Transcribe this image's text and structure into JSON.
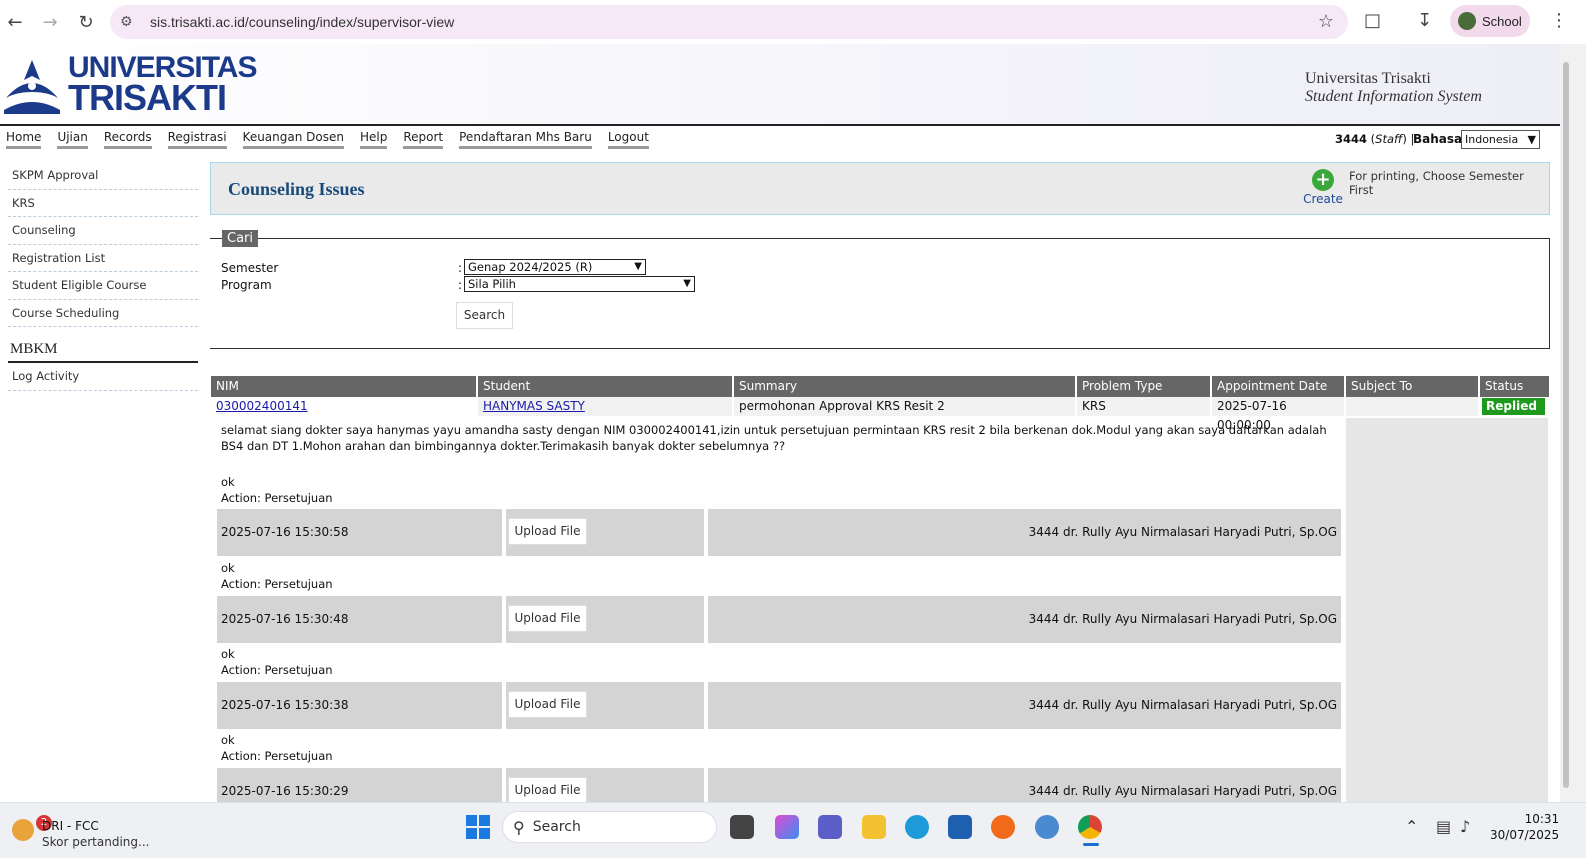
{
  "browser": {
    "url": "sis.trisakti.ac.id/counseling/index/supervisor-view",
    "profile_label": "School"
  },
  "header": {
    "logo_line1": "UNIVERSITAS",
    "logo_line2": "TRISAKTI",
    "university_name": "Universitas Trisakti",
    "system_name": "Student Information System"
  },
  "menu": {
    "items": [
      "Home",
      "Ujian",
      "Records",
      "Registrasi",
      "Keuangan Dosen",
      "Help",
      "Report",
      "Pendaftaran Mhs Baru",
      "Logout"
    ],
    "user_id": "3444",
    "user_role": "Staff",
    "language_label": "Bahasa:",
    "language_value": "Indonesia"
  },
  "sidebar": {
    "items": [
      "SKPM Approval",
      "KRS",
      "Counseling",
      "Registration List",
      "Student Eligible Course",
      "Course Scheduling"
    ],
    "mbkm_heading": "MBKM",
    "mbkm_items": [
      "Log Activity"
    ]
  },
  "page": {
    "title": "Counseling Issues",
    "create_label": "Create",
    "print_note": "For printing, Choose Semester First"
  },
  "search": {
    "legend": "Cari",
    "semester_label": "Semester",
    "semester_value": "Genap 2024/2025 (R)",
    "program_label": "Program",
    "program_value": "Sila Pilih",
    "button_label": "Search"
  },
  "table": {
    "headers": [
      "NIM",
      "Student",
      "Summary",
      "Problem Type",
      "Appointment Date",
      "Subject To",
      "Status"
    ],
    "row": {
      "nim": "030002400141",
      "student": "HANYMAS SASTY",
      "summary": "permohonan Approval KRS Resit 2",
      "problem_type": "KRS",
      "appointment_date": "2025-07-16 00:00:00",
      "subject_to": "",
      "status": "Replied"
    },
    "message": "selamat siang dokter saya hanymas yayu amandha sasty dengan NIM 030002400141,izin untuk persetujuan permintaan KRS resit 2 bila berkenan dok.Modul yang akan saya daftarkan adalah BS4 dan DT 1.Mohon arahan dan bimbingannya dokter.Terimakasih banyak dokter sebelumnya ??",
    "replies": [
      {
        "text": "ok",
        "action": "Action: Persetujuan",
        "date": "2025-07-16 15:30:58",
        "upload": "Upload File",
        "author": "3444 dr. Rully Ayu Nirmalasari Haryadi Putri, Sp.OG"
      },
      {
        "text": "ok",
        "action": "Action: Persetujuan",
        "date": "2025-07-16 15:30:48",
        "upload": "Upload File",
        "author": "3444 dr. Rully Ayu Nirmalasari Haryadi Putri, Sp.OG"
      },
      {
        "text": "ok",
        "action": "Action: Persetujuan",
        "date": "2025-07-16 15:30:38",
        "upload": "Upload File",
        "author": "3444 dr. Rully Ayu Nirmalasari Haryadi Putri, Sp.OG"
      },
      {
        "text": "ok",
        "action": "Action: Persetujuan",
        "date": "2025-07-16 15:30:29",
        "upload": "Upload File",
        "author": "3444 dr. Rully Ayu Nirmalasari Haryadi Putri, Sp.OG"
      }
    ]
  },
  "taskbar": {
    "weather_badge": "2",
    "weather_title": "DRI - FCC",
    "weather_sub": "Skor pertanding...",
    "search_placeholder": "Search",
    "time": "10:31",
    "date": "30/07/2025"
  }
}
